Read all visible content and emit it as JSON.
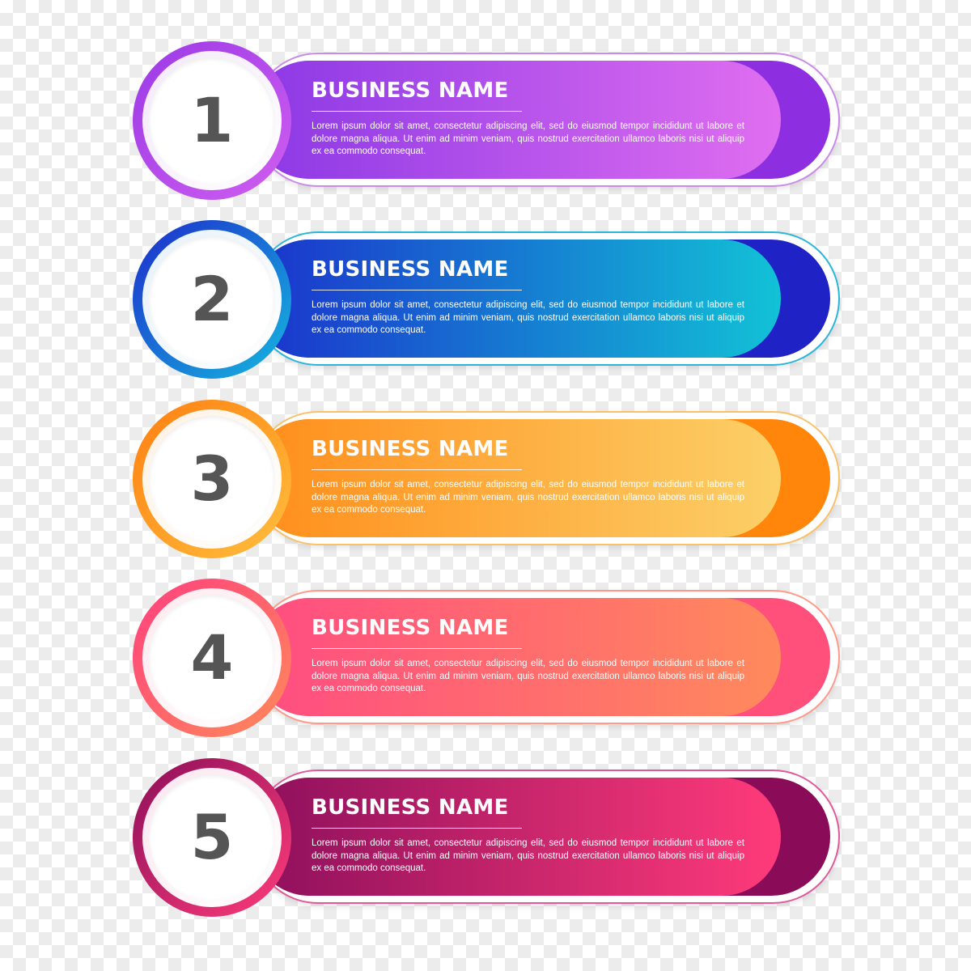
{
  "items": [
    {
      "number": "1",
      "title": "BUSINESS NAME",
      "text": "Lorem ipsum dolor sit amet, consectetur adipiscing elit, sed do eiusmod tempor incididunt ut labore et dolore magna aliqua. Ut enim ad minim veniam, quis nostrud exercitation ullamco laboris nisi ut aliquip ex ea commodo consequat.",
      "color": "#9b3ae6"
    },
    {
      "number": "2",
      "title": "BUSINESS NAME",
      "text": "Lorem ipsum dolor sit amet, consectetur adipiscing elit, sed do eiusmod tempor incididunt ut labore et dolore magna aliqua. Ut enim ad minim veniam, quis nostrud exercitation ullamco laboris nisi ut aliquip ex ea commodo consequat.",
      "color": "#1d2ccc"
    },
    {
      "number": "3",
      "title": "BUSINESS NAME",
      "text": "Lorem ipsum dolor sit amet, consectetur adipiscing elit, sed do eiusmod tempor incididunt ut labore et dolore magna aliqua. Ut enim ad minim veniam, quis nostrud exercitation ullamco laboris nisi ut aliquip ex ea commodo consequat.",
      "color": "#ff860b"
    },
    {
      "number": "4",
      "title": "BUSINESS NAME",
      "text": "Lorem ipsum dolor sit amet, consectetur adipiscing elit, sed do eiusmod tempor incididunt ut labore et dolore magna aliqua. Ut enim ad minim veniam, quis nostrud exercitation ullamco laboris nisi ut aliquip ex ea commodo consequat.",
      "color": "#ff4f7b"
    },
    {
      "number": "5",
      "title": "BUSINESS NAME",
      "text": "Lorem ipsum dolor sit amet, consectetur adipiscing elit, sed do eiusmod tempor incididunt ut labore et dolore magna aliqua. Ut enim ad minim veniam, quis nostrud exercitation ullamco laboris nisi ut aliquip ex ea commodo consequat.",
      "color": "#8a0c58"
    }
  ]
}
